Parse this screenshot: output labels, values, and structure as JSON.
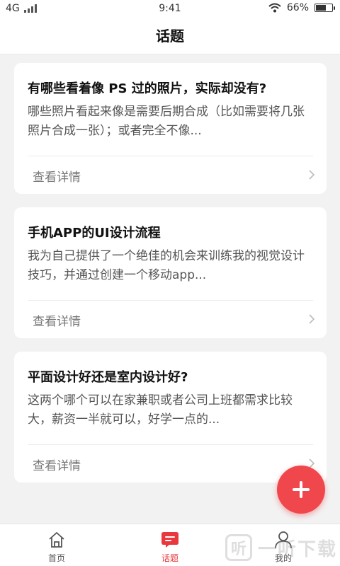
{
  "status_bar": {
    "network": "4G",
    "time": "9:41",
    "battery_percent": "66%",
    "battery_level": 0.66
  },
  "header": {
    "title": "话题"
  },
  "topics": [
    {
      "title": "有哪些看着像 PS 过的照片，实际却没有?",
      "description": "哪些照片看起来像是需要后期合成（比如需要将几张照片合成一张）；或者完全不像...",
      "detail_label": "查看详情"
    },
    {
      "title": "手机APP的UI设计流程",
      "description": "我为自己提供了一个绝佳的机会来训练我的视觉设计技巧，并通过创建一个移动app...",
      "detail_label": "查看详情"
    },
    {
      "title": "平面设计好还是室内设计好?",
      "description": "这两个哪个可以在家兼职或者公司上班都需求比较大，薪资一半就可以，好学一点的...",
      "detail_label": "查看详情"
    }
  ],
  "fab": {
    "icon": "plus-icon",
    "color": "#f0474d"
  },
  "bottom_nav": {
    "items": [
      {
        "label": "首页",
        "icon": "home-icon",
        "active": false
      },
      {
        "label": "话题",
        "icon": "chat-icon",
        "active": true
      },
      {
        "label": "我的",
        "icon": "user-icon",
        "active": false
      }
    ],
    "active_color": "#e8383d"
  },
  "watermark": {
    "text": "一听下载"
  }
}
